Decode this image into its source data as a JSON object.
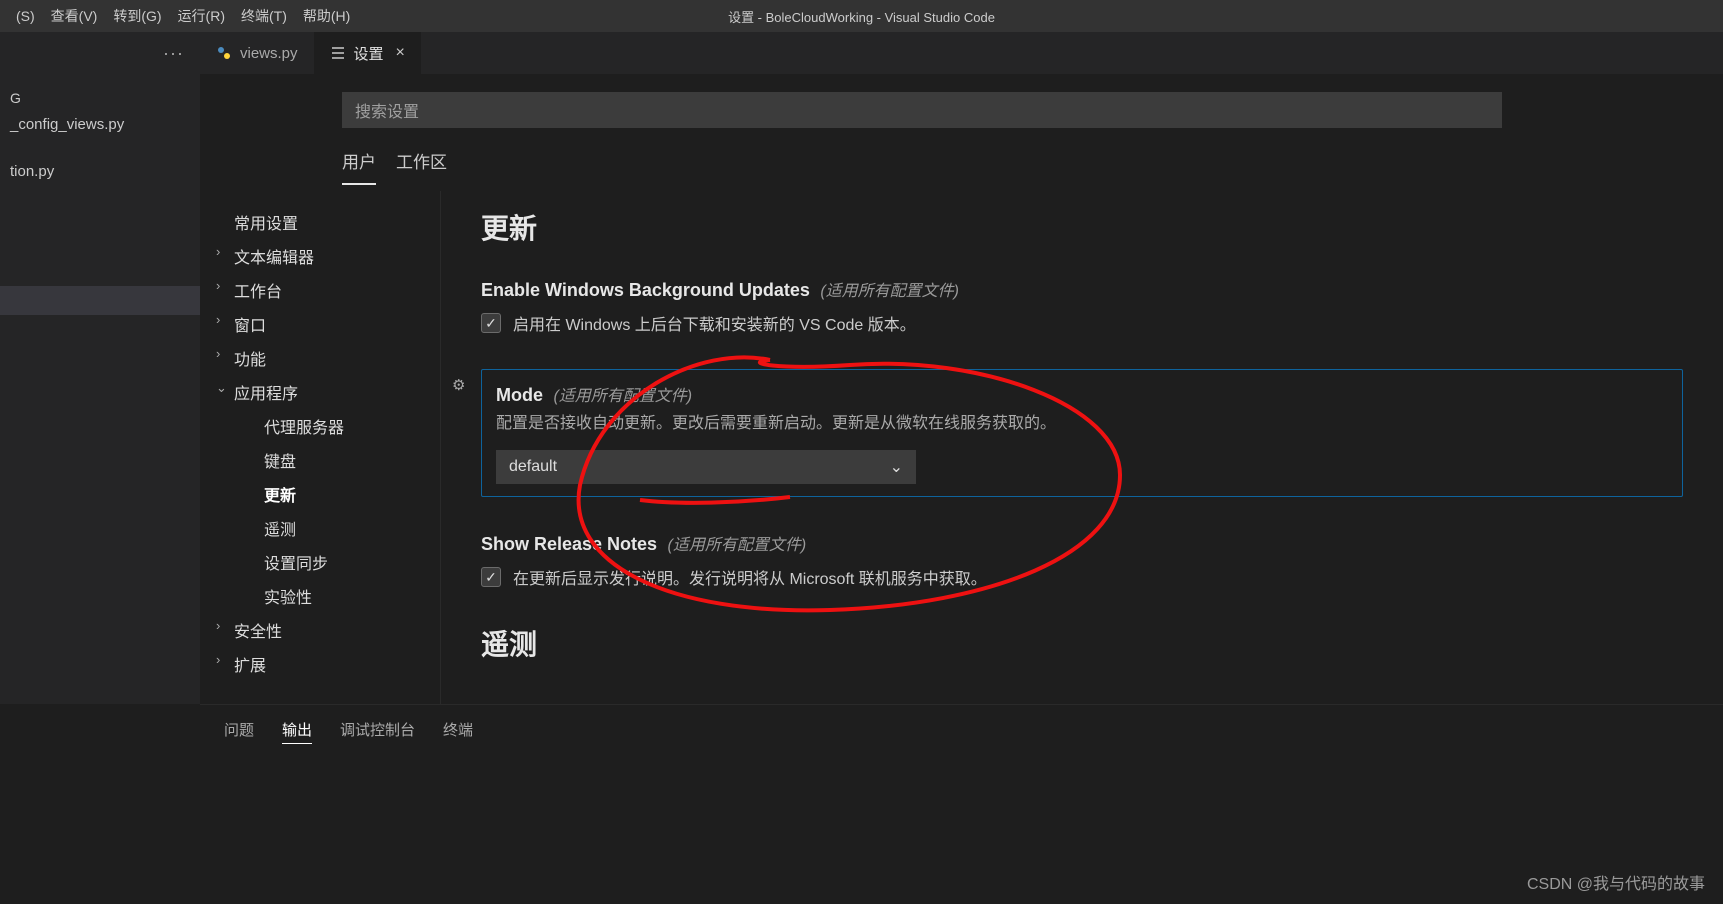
{
  "menubar": {
    "items": [
      "(S)",
      "查看(V)",
      "转到(G)",
      "运行(R)",
      "终端(T)",
      "帮助(H)"
    ]
  },
  "window_title": "设置 - BoleCloudWorking - Visual Studio Code",
  "explorer": {
    "header": "G",
    "files": [
      "_config_views.py",
      "tion.py"
    ]
  },
  "tabs": {
    "file_tab": "views.py",
    "settings_tab": "设置"
  },
  "search_placeholder": "搜索设置",
  "scope": {
    "user": "用户",
    "workspace": "工作区"
  },
  "toc": {
    "common": "常用设置",
    "editor": "文本编辑器",
    "workbench": "工作台",
    "window": "窗口",
    "features": "功能",
    "app": "应用程序",
    "proxy": "代理服务器",
    "keyboard": "键盘",
    "update": "更新",
    "telemetry": "遥测",
    "sync": "设置同步",
    "experimental": "实验性",
    "security": "安全性",
    "extensions": "扩展"
  },
  "content": {
    "heading_update": "更新",
    "ewbu_title": "Enable Windows Background Updates",
    "scope_note": "(适用所有配置文件)",
    "ewbu_desc": "启用在 Windows 上后台下载和安装新的 VS Code 版本。",
    "mode_title": "Mode",
    "mode_desc": "配置是否接收自动更新。更改后需要重新启动。更新是从微软在线服务获取的。",
    "mode_value": "default",
    "srn_title": "Show Release Notes",
    "srn_desc": "在更新后显示发行说明。发行说明将从 Microsoft 联机服务中获取。",
    "heading_telemetry": "遥测"
  },
  "panel": {
    "tabs": [
      "问题",
      "输出",
      "调试控制台",
      "终端"
    ]
  },
  "watermark": "CSDN @我与代码的故事"
}
